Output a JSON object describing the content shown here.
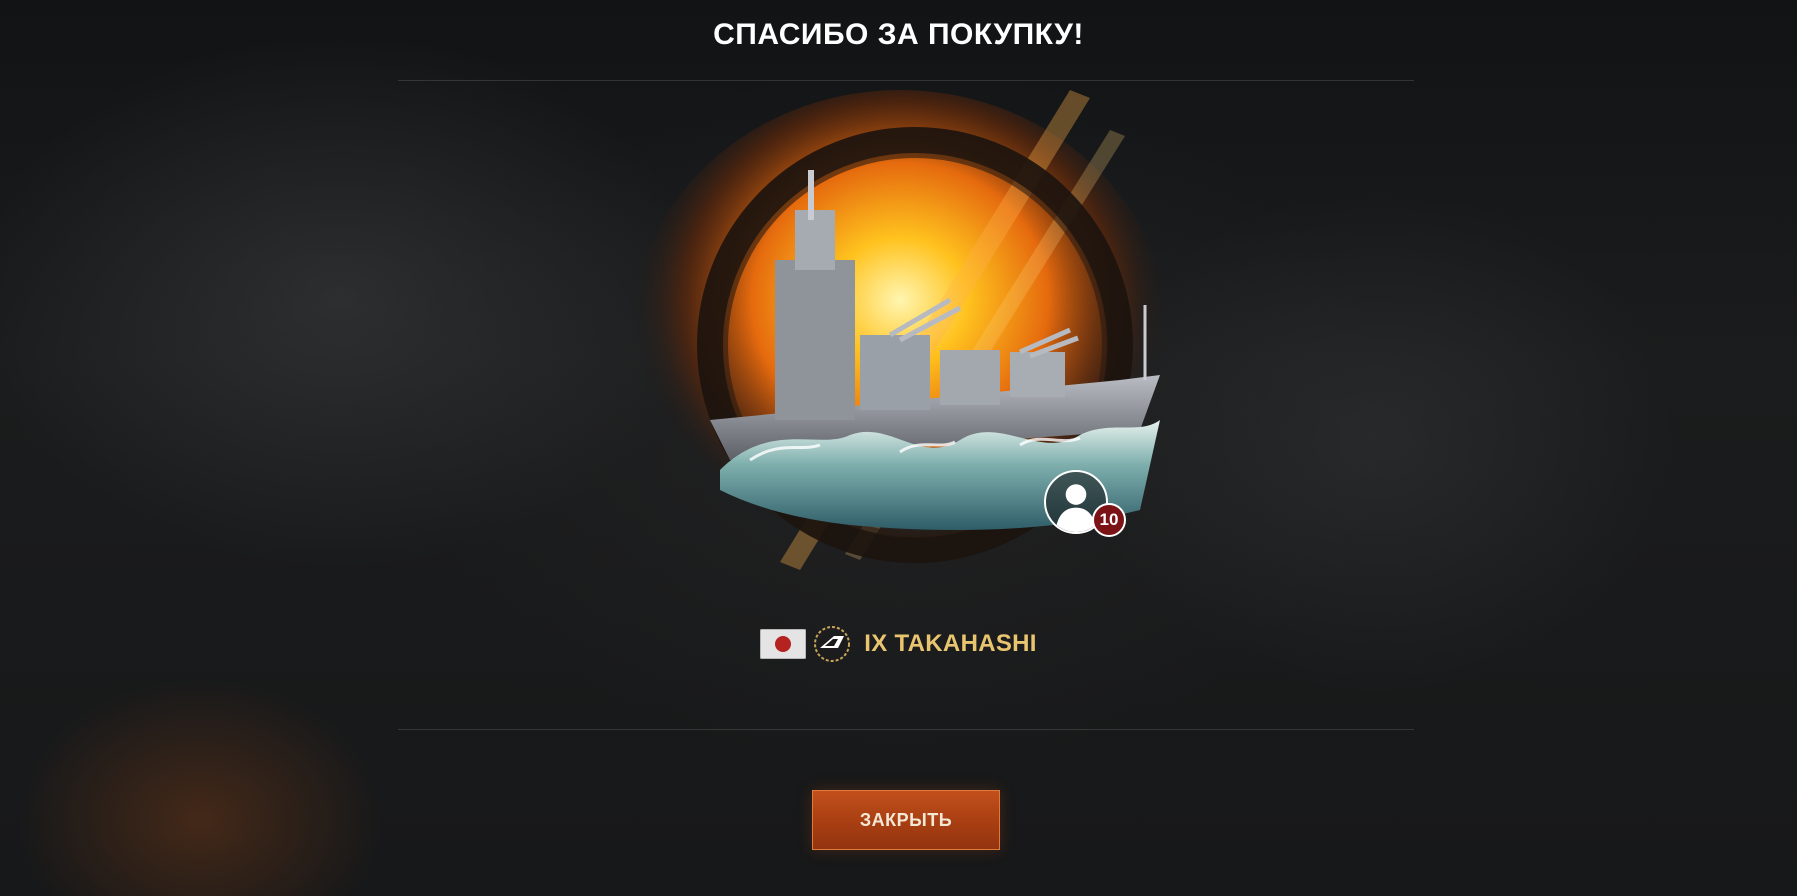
{
  "dialog": {
    "title": "СПАСИБО ЗА ПОКУПКУ!"
  },
  "reward": {
    "tier": "IX",
    "ship_name": "IX TAKAHASHI",
    "nation_icon": "japan-flag-icon",
    "class_icon": "cruiser-class-icon",
    "commander_icon": "commander-silhouette-icon",
    "commander_level": "10"
  },
  "actions": {
    "close_label": "ЗАКРЫТЬ"
  },
  "colors": {
    "accent_button": "#b5461a",
    "ship_name": "#e9c56f",
    "badge": "#7a1216"
  }
}
